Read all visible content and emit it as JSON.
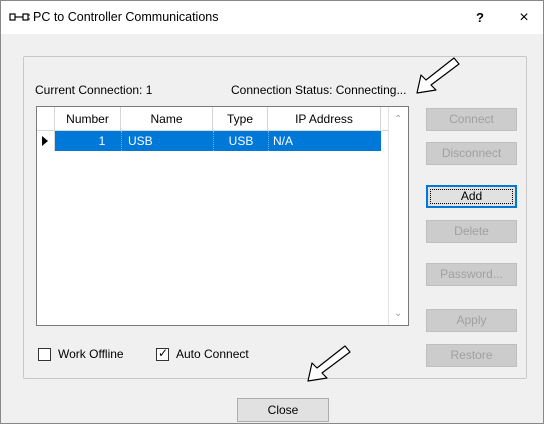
{
  "window": {
    "title": "PC to Controller Communications",
    "help": "?",
    "close": "×"
  },
  "status": {
    "current_connection": "Current Connection: 1",
    "connection_status": "Connection Status: Connecting..."
  },
  "table": {
    "columns": [
      "Number",
      "Name",
      "Type",
      "IP Address"
    ],
    "rows": [
      {
        "number": "1",
        "name": "USB",
        "type": "USB",
        "ip": "N/A",
        "selected": true
      }
    ]
  },
  "buttons": {
    "connect": "Connect",
    "disconnect": "Disconnect",
    "add": "Add",
    "delete": "Delete",
    "password": "Password...",
    "apply": "Apply",
    "restore": "Restore",
    "close": "Close"
  },
  "options": {
    "work_offline": {
      "label": "Work Offline",
      "checked": false
    },
    "auto_connect": {
      "label": "Auto Connect",
      "checked": true
    }
  },
  "colors": {
    "selection": "#0078d7",
    "disabled_text": "#a0a0a0"
  }
}
